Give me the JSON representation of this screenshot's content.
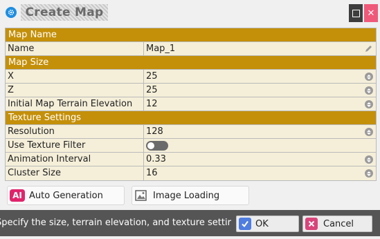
{
  "window": {
    "title": "Create Map"
  },
  "sections": {
    "map_name": "Map Name",
    "map_size": "Map Size",
    "texture": "Texture Settings"
  },
  "fields": {
    "name": {
      "label": "Name",
      "value": "Map_1"
    },
    "x": {
      "label": "X",
      "value": "25"
    },
    "z": {
      "label": "Z",
      "value": "25"
    },
    "elevation": {
      "label": "Initial Map Terrain Elevation",
      "value": "12"
    },
    "resolution": {
      "label": "Resolution",
      "value": "128"
    },
    "texture_filter": {
      "label": "Use Texture Filter",
      "enabled": false
    },
    "animation_interval": {
      "label": "Animation Interval",
      "value": "0.33"
    },
    "cluster_size": {
      "label": "Cluster Size",
      "value": "16"
    }
  },
  "tools": {
    "auto_generation": {
      "label": "Auto Generation",
      "badge": "AI"
    },
    "image_loading": {
      "label": "Image Loading"
    }
  },
  "status": {
    "message": "Specify the size, terrain elevation, and texture settir"
  },
  "buttons": {
    "ok": "OK",
    "cancel": "Cancel"
  },
  "colors": {
    "section_header": "#c4900a",
    "row_background": "#f5efd9",
    "status_bar": "#555555",
    "ai_badge": "#e0246b",
    "ok_icon": "#4f7de0",
    "cancel_icon": "#d9457a",
    "close_button": "#f05a7a"
  },
  "icons": {
    "app": "gear-icon",
    "maximize": "maximize-icon",
    "close": "close-icon",
    "edit": "pencil-icon",
    "spinner": "spinner-icon",
    "image": "image-icon",
    "ok": "checkmark-icon",
    "cancel": "x-icon"
  }
}
